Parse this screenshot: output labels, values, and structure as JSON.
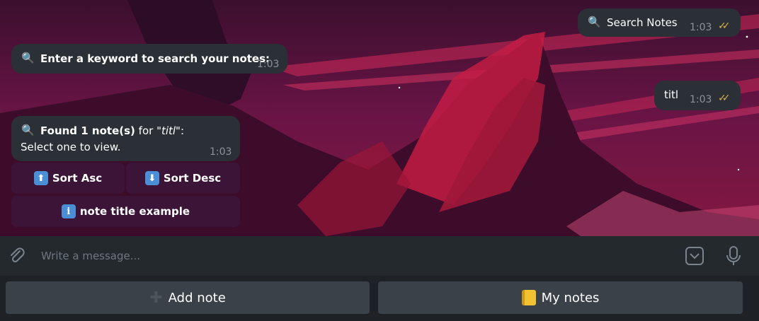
{
  "messages": {
    "out_search": {
      "text": "Search Notes",
      "time": "1:03",
      "icon": "magnifier-icon"
    },
    "in_prompt": {
      "text": "Enter a keyword to search your notes:",
      "time": "1:03",
      "icon": "magnifier-icon"
    },
    "out_titl": {
      "text": "titl",
      "time": "1:03"
    },
    "in_found": {
      "bold": "Found 1 note(s)",
      "mid": " for ",
      "query": "\"titl\"",
      "end": ":",
      "line2": "Select one to view.",
      "time": "1:03",
      "icon": "magnifier-icon"
    }
  },
  "inline_keyboard": {
    "sort_asc": "Sort Asc",
    "sort_desc": "Sort Desc",
    "note": "note title example"
  },
  "composer": {
    "placeholder": "Write a message..."
  },
  "reply_keyboard": {
    "add_note": "Add note",
    "my_notes": "My notes"
  },
  "colors": {
    "bubble": "#2b3036",
    "checks": "#d9b34a",
    "accent_blue": "#4a8fd6"
  }
}
